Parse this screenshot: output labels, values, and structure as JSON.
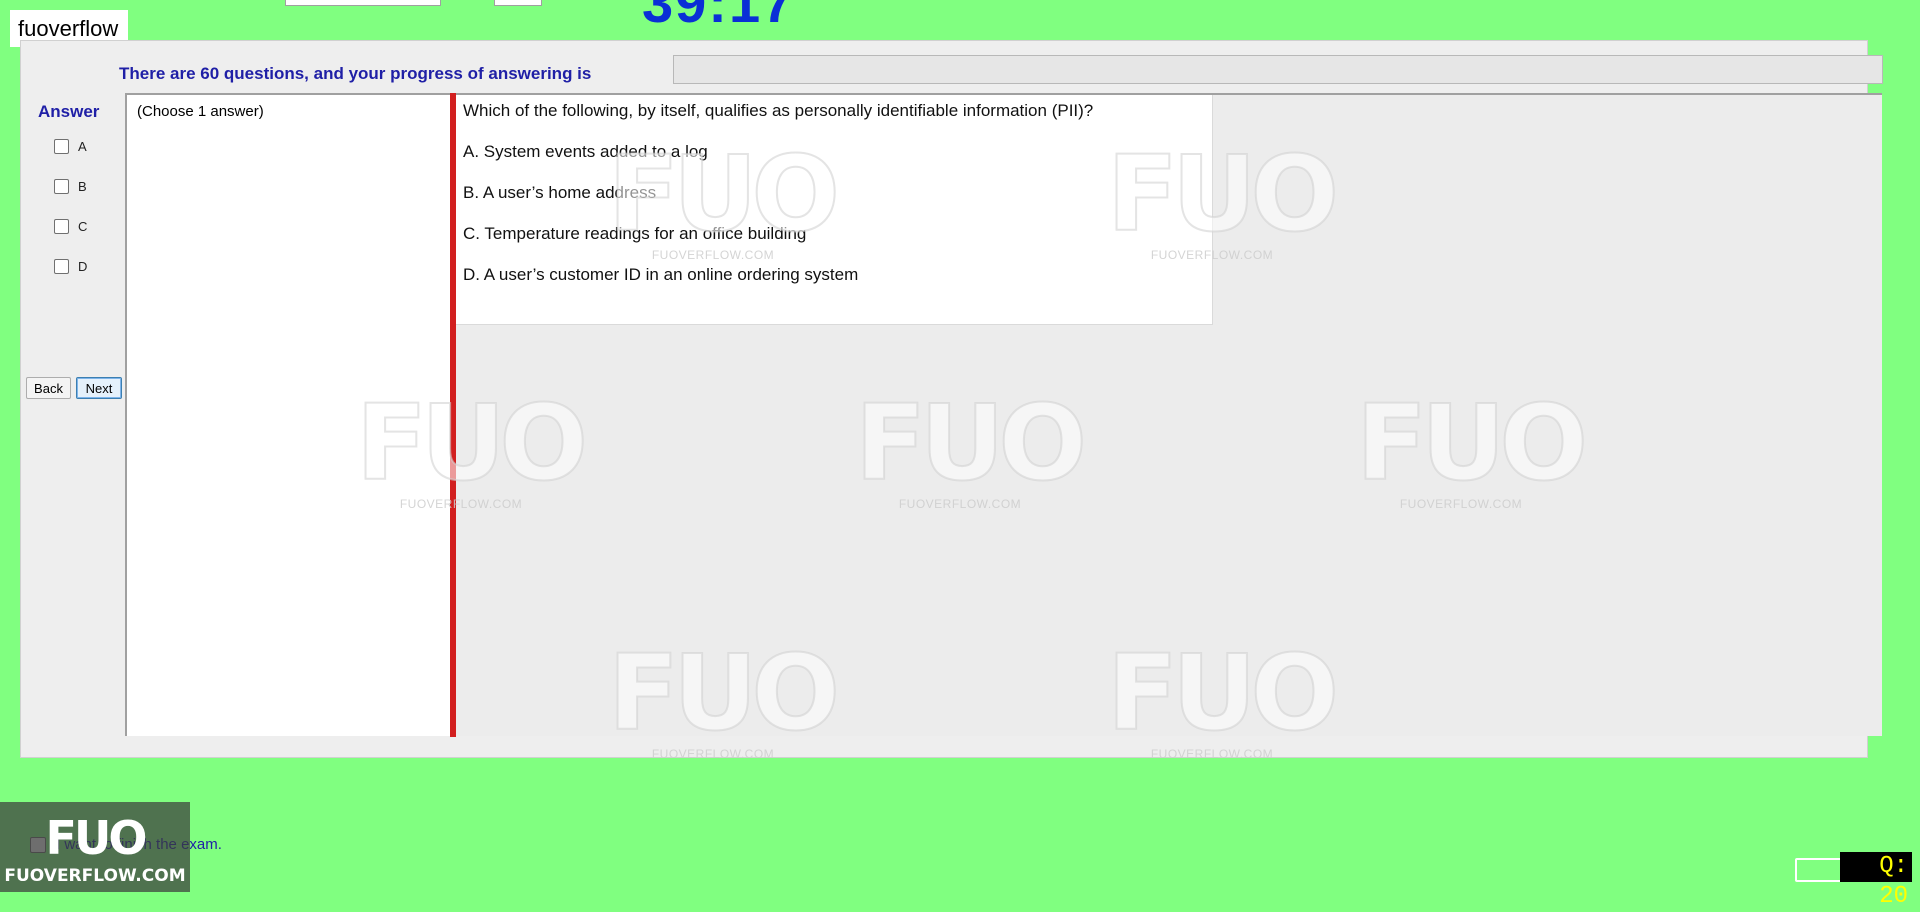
{
  "timer": "39:17",
  "brand": {
    "label": "fuoverflow",
    "logo": "FUO",
    "site": "FUOVERFLOW.COM"
  },
  "progress": {
    "label": "There are 60 questions, and your progress of answering is",
    "fraction": 0
  },
  "answer": {
    "title": "Answer",
    "options": [
      "A",
      "B",
      "C",
      "D"
    ]
  },
  "nav": {
    "back_label": "Back",
    "next_label": "Next"
  },
  "choose_text": "(Choose 1 answer)",
  "question": {
    "text": "Which of the following, by itself, qualifies as personally identifiable information (PII)?",
    "options": [
      "A.  System events added to a log",
      "B.  A user’s home address",
      "C.  Temperature readings for an office building",
      "D.  A user’s customer ID in an online ordering system"
    ]
  },
  "finish_label": "I want to finish the exam.",
  "question_counter": "Q: 20",
  "watermark": {
    "logo": "FUO",
    "site": "FUOVERFLOW.COM"
  },
  "colors": {
    "background": "#80ff80",
    "accent_text": "#1f1fa6",
    "timer": "#0a2fd6",
    "splitter": "#d21f1f",
    "counter_text": "#ffff00"
  }
}
